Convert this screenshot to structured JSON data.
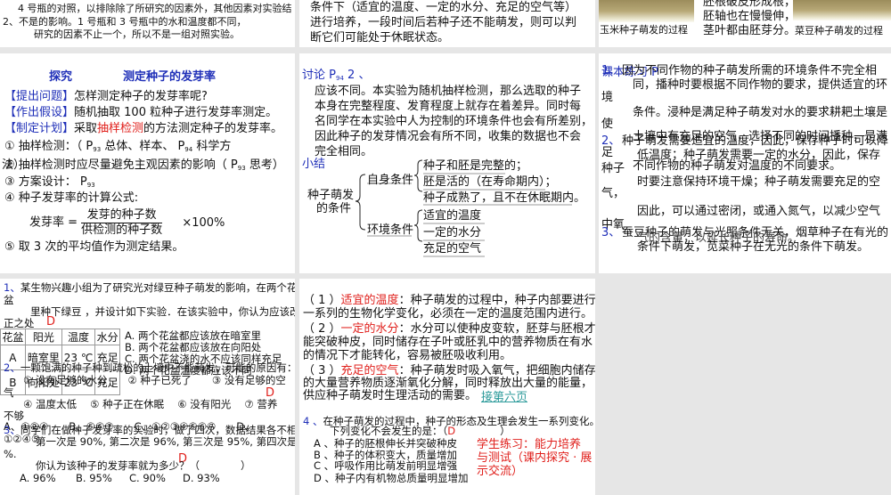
{
  "slide1": {
    "line1": "4 号瓶的对照，以排除除了所研究的因素外，其他因素对实验结",
    "line2": "2、不是的影响。1 号瓶和 3 号瓶中的水和温度都不同，",
    "line3": "研究的因素不止一个，所以不是一组对照实验。"
  },
  "slide2": {
    "line1": "条件下（适宜的温度、一定的水分、充足的空气等）",
    "line2": "进行培养，一段时间后若种子还不能萌发，则可以判",
    "line3": "断它们可能处于休眠状态。"
  },
  "slide3": {
    "caption1": "玉米种子萌发的过程",
    "caption2": "菜豆种子萌发的过程",
    "line1": "胚根破皮形成根，",
    "line2": "胚轴也在慢慢伸，",
    "line3": "茎叶都由胚芽分。"
  },
  "slide4": {
    "title_a": "探究",
    "title_b": "测定种子的发芽率",
    "q_label": "【提出问题】",
    "q_text": "怎样测定种子的发芽率呢?",
    "h_label": "【作出假设】",
    "h_text": "随机抽取 100 粒种子进行发芽率测定。",
    "p_label": "【制定计划】",
    "p_pre": "采取",
    "p_red": "抽样检测",
    "p_post": "的方法测定种子的发芽率。",
    "item1_a": "①  抽样检测：（ P",
    "item1_sub1": "93",
    "item1_b": " 总体、样本、 P",
    "item1_sub2": "94",
    "item1_c": " 科学方",
    "item1_wrap": "法）",
    "item2_a": "②  抽样检测时应尽量避免主观因素的影响（ P",
    "item2_sub": "93",
    "item2_b": " 思考）",
    "item3_a": "③  方案设计： P",
    "item3_sub": "93",
    "item4": "④  种子发芽率的计算公式:",
    "formula_label": "发芽率  =",
    "formula_num": "发芽的种子数",
    "formula_den": "供检测的种子数",
    "formula_mult": "×100%",
    "item5": "⑤  取 3 次的平均值作为测定结果。"
  },
  "slide5": {
    "discuss_a": "讨论 P",
    "discuss_sub": "94",
    "discuss_b": " 2 、",
    "para": [
      "应该不同。本实验为随机抽样检测，那么选取的种子",
      "本身在完整程度、发育程度上就存在着差异。同时每",
      "名同学在本实验中人为控制的环境条件也会有所差别，",
      "因此种子的发芽情况会有所不同，收集的数据也不会",
      "完全相同。"
    ],
    "summary": "小结",
    "root_a": "种子萌发",
    "root_b": "的条件",
    "self": "自身条件",
    "env": "环境条件",
    "self_items": [
      "种子和胚是完整的；",
      "胚是活的（在寿命期内）；",
      "种子成熟了，且不在休眠期内。"
    ],
    "env_items": [
      "适宜的温度",
      "一定的水分",
      "充足的空气"
    ]
  },
  "slide6": {
    "label": "课本练习 P",
    "n1": "1、",
    "l1": "因为不同作物的种子萌发所需的环境条件不完全相",
    "l2": "同，播种时要根据不同作物的要求，提供适宜的环",
    "w1": "境",
    "l3": "条件。浸种是满足种子萌发对水的要求耕耙土壤是",
    "w2": "使",
    "l4": "土壤中有充足的空气，选择不同的时间播种，是满",
    "n2": "2、",
    "l5": "种子萌发需要适宜的温度，因此，保存种子时可以降",
    "w3": "足",
    "l6": "低温度；种子萌发需要一定的水分，因此，保存",
    "w4": "种子",
    "l7": "不同作物的种子萌发对温度的不同要求。",
    "l8": "时要注意保持环境干燥；种子萌发需要充足的空",
    "w5": "气，",
    "l9": "因此，可以通过密闭，或通入氮气，以减少空气",
    "w6": "中氧",
    "n3": "3、",
    "l10": "蚕豆种子的萌发与光照条件无关，烟草种子在有光的",
    "l11": "气的含量，以延长种子的寿命。",
    "l12": "条件下萌发，苋菜种子在无光的条件下萌发。"
  },
  "slide7": {
    "q1_n": "1、",
    "q1_l1": "某生物兴趣小组为了研究光对绿豆种子萌发的影响，在两个花",
    "q1_w1": "盆",
    "q1_l2": "里种下绿豆 ，并设计如下实验．在该实验中，你认为应该改",
    "q1_w2": "正之处",
    "q1_answer": "D",
    "table_headers": [
      "花盆",
      "阳光",
      "温度",
      "水分"
    ],
    "table_rows": [
      [
        "A",
        "暗室里",
        "23 ℃",
        "充足"
      ],
      [
        "B",
        "向阳处",
        "23 ℃",
        "充足"
      ]
    ],
    "q1_options": [
      "A. 两个花盆都应该放在暗室里",
      "B. 两个花盆都应该放在向阳处",
      "C. 两个花盆浇的水不应该同样充足",
      "D. 两个花盆温度都应该不同"
    ],
    "q2_n": "2、",
    "q2_l1": "一颗饱满的种子种到疏松的土壤中不能萌发，可能的原因有：",
    "q2_l2": "① 没有足够的水分　　② 种子已死了　　③ 没有足够的空",
    "q2_w1": "气",
    "q2_answer": "D",
    "q2_l3": "④  温度太低　 ⑤  种子正在休眠　 ⑥  没有阳光　 ⑦  营养",
    "q2_w2": "不够",
    "q2_options": "A、①②④　　B、⑤⑥⑦　　C、①②③④⑤⑥⑦　　D、",
    "q3_n": "3、",
    "q3_l1": "同学们在做种子发芽率的实验时，做了四次，数据结果各不相同，",
    "q2_opt_d": "①②④⑤",
    "q3_l2": "第一次是 90%, 第二次是 96%, 第三次是 95%, 第四次是 91",
    "q3_w1": "%.",
    "q3_answer": "D",
    "q3_l3": "你认为该种子的发芽率就为多少？（　　　　）",
    "q3_options": [
      "A. 96%",
      "B. 95%",
      "C. 90%",
      "D. 93%"
    ]
  },
  "slide8": {
    "p1_n": "（ 1 ）",
    "p1_red": "适宜的温度",
    "p1_text": "：种子萌发的过程中，种子内部要进行",
    "p1_l2": "一系列的生物化学变化，必须在一定的温度范围内进行。",
    "p2_n": "（ 2 ）",
    "p2_red": "一定的水分",
    "p2_text": "：水分可以使种皮变软，胚芽与胚根才",
    "p2_l2": "能突破种皮，同时储存在子叶或胚乳中的营养物质在有水",
    "p2_l3": "的情况下才能转化，容易被胚吸收利用。",
    "p3_n": "（ 3 ）",
    "p3_red": "充足的空气",
    "p3_text": "：种子萌发时吸入氧气，把细胞内储存",
    "p3_l2": "的大量营养物质逐渐氧化分解，同时释放出大量的能量，",
    "p3_l3": "供应种子萌发时生理活动的需要。",
    "link": "接第六页",
    "q4_n": "4 、",
    "q4_l1": "在种子萌发的过程中，种子的形态及生理会发生一系列变化。",
    "q4_l2": "下列变化不会发生的是：（",
    "q4_answer": "D",
    "q4_close": "）",
    "q4_options": [
      "A 、种子的胚根伸长并突破种皮",
      "B 、种子的体积变大，质量增加",
      "C 、呼吸作用比萌发前明显增强",
      "D 、种子内有机物总质量明显增加"
    ],
    "practice": [
      "学生练习：能力培养",
      "与测试（课内探究 · 展",
      "示交流）"
    ]
  }
}
